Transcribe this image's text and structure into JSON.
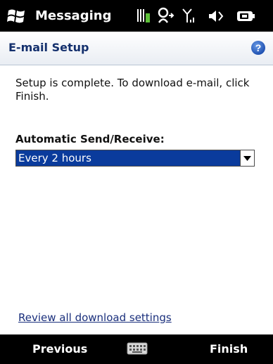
{
  "statusbar": {
    "app_title": "Messaging",
    "icons": [
      "windows-start-icon",
      "phone-mute-icon",
      "data-connection-icon",
      "signal-icon",
      "speaker-icon",
      "battery-icon"
    ]
  },
  "header": {
    "title": "E-mail Setup",
    "help_icon": "help-icon"
  },
  "content": {
    "message": "Setup is complete.  To download e-mail, click Finish.",
    "send_receive_label": "Automatic Send/Receive:",
    "send_receive_value": "Every 2 hours",
    "review_link": "Review all download settings"
  },
  "softkeys": {
    "left": "Previous",
    "right": "Finish",
    "center_icon": "keyboard-icon"
  },
  "colors": {
    "bar_background": "#000000",
    "header_title": "#14306d",
    "dropdown_selected_bg": "#0a3b9c",
    "link": "#1a2f7c"
  }
}
